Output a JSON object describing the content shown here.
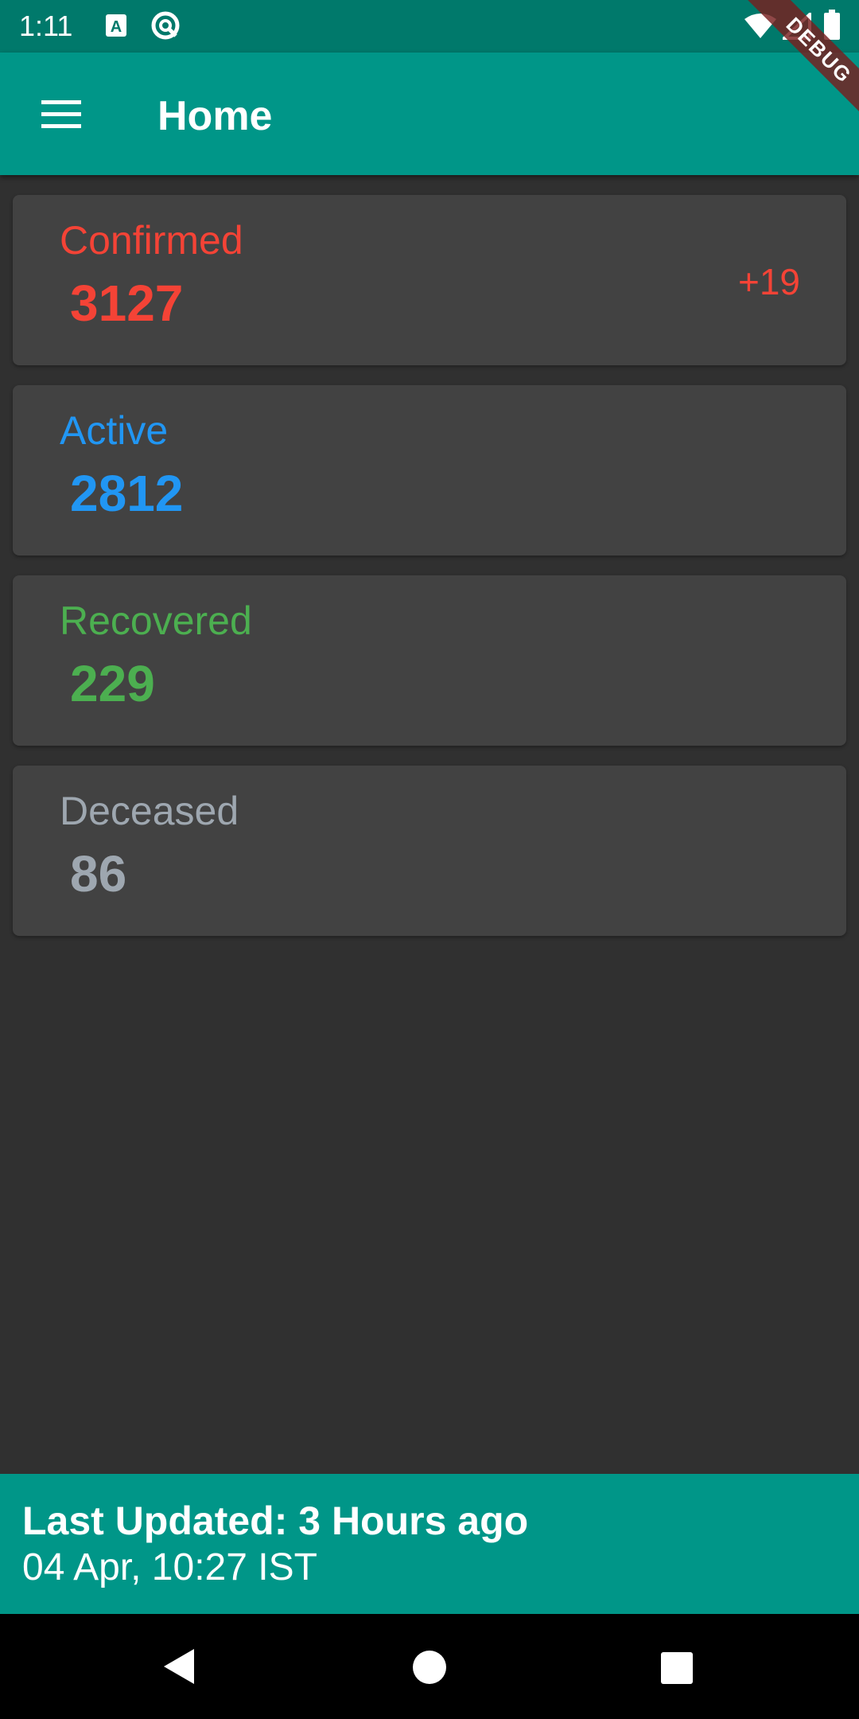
{
  "status_bar": {
    "time": "1:11",
    "icons": [
      "text-a-icon",
      "at-sync-icon",
      "wifi-icon",
      "cellular-signal-icon",
      "battery-icon"
    ]
  },
  "debug_banner": "DEBUG",
  "app_bar": {
    "menu_icon": "hamburger-menu-icon",
    "title": "Home"
  },
  "stats": [
    {
      "label": "Confirmed",
      "value": "3127",
      "delta": "+19",
      "color": "#F44336"
    },
    {
      "label": "Active",
      "value": "2812",
      "delta": "",
      "color": "#2196F3"
    },
    {
      "label": "Recovered",
      "value": "229",
      "delta": "",
      "color": "#4CAF50"
    },
    {
      "label": "Deceased",
      "value": "86",
      "delta": "",
      "color": "#9EA7B0"
    }
  ],
  "footer": {
    "last_updated": "Last Updated: 3 Hours ago",
    "timestamp": "04 Apr, 10:27 IST"
  },
  "nav_bar": {
    "back": "back-triangle-icon",
    "home": "home-circle-icon",
    "recents": "recents-square-icon"
  },
  "colors": {
    "primary": "#009688",
    "status_bar": "#00796B",
    "background": "#303030",
    "card": "#424242"
  }
}
